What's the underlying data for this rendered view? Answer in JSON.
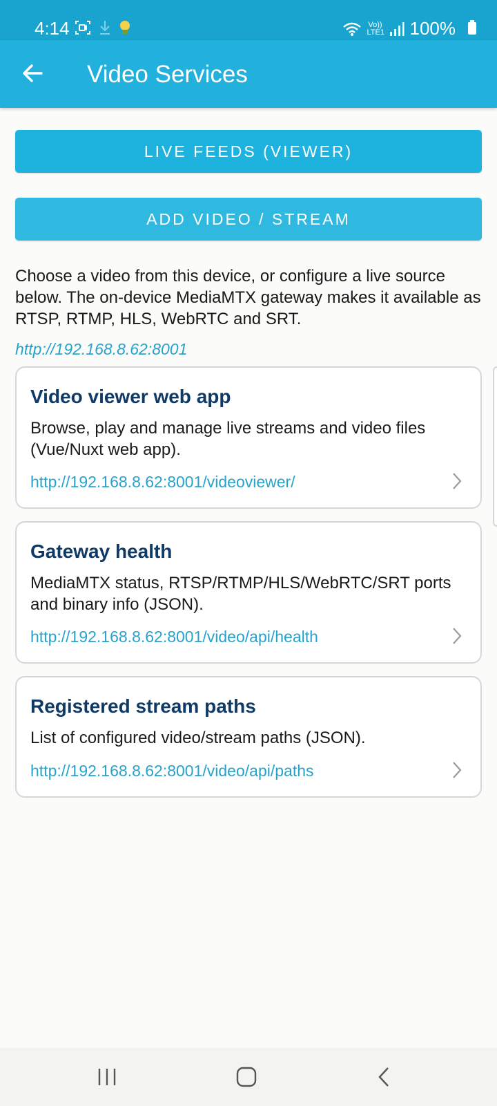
{
  "status_bar": {
    "time": "4:14",
    "network": "Vo)) LTE1",
    "battery": "100%"
  },
  "app_bar": {
    "title": "Video Services"
  },
  "buttons": {
    "live_feeds": "LIVE FEEDS (VIEWER)",
    "add_video": "ADD VIDEO / STREAM"
  },
  "intro_text": "Choose a video from this device, or configure a live source below. The on-device MediaMTX gateway makes it available as RTSP, RTMP, HLS, WebRTC and SRT.",
  "base_url": "http://192.168.8.62:8001",
  "cards": [
    {
      "title": "Video viewer web app",
      "description": "Browse, play and manage live streams and video files (Vue/Nuxt web app).",
      "url": "http://192.168.8.62:8001/videoviewer/"
    },
    {
      "title": "Gateway health",
      "description": "MediaMTX status, RTSP/RTMP/HLS/WebRTC/SRT ports and binary info (JSON).",
      "url": "http://192.168.8.62:8001/video/api/health"
    },
    {
      "title": "Registered stream paths",
      "description": "List of configured video/stream paths (JSON).",
      "url": "http://192.168.8.62:8001/video/api/paths"
    }
  ],
  "colors": {
    "status_bar": "#18a4cf",
    "app_bar": "#22b1dd",
    "button": "#1eb2df",
    "link": "#27a3cb",
    "card_title": "#103a66"
  },
  "icons": {
    "back": "arrow-left-icon",
    "chevron": "chevron-right-icon",
    "nav_recents": "recents-icon",
    "nav_home": "home-icon",
    "nav_back": "back-icon"
  }
}
